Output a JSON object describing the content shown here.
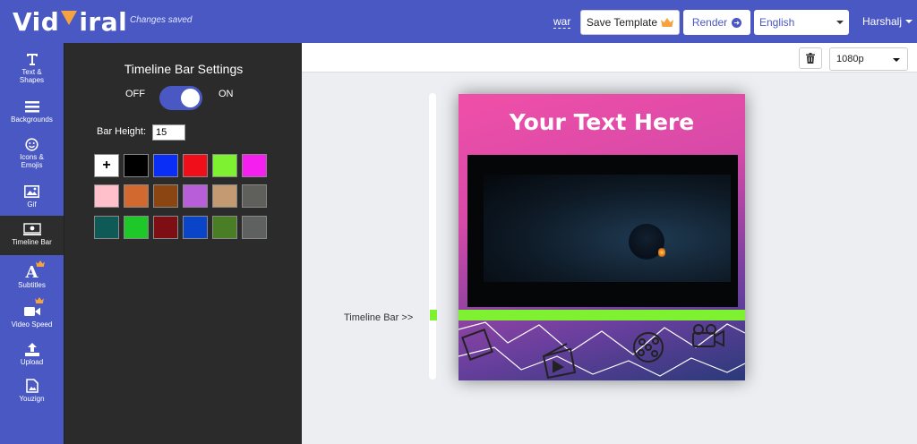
{
  "header": {
    "logo_left": "Vid",
    "logo_right": "iral",
    "status": "Changes saved",
    "war_link": "war",
    "save_template_label": "Save Template",
    "render_label": "Render",
    "language": "English",
    "user": "Harshalj"
  },
  "sidebar": {
    "items": [
      {
        "label": "Text &\nShapes",
        "icon": "text-icon"
      },
      {
        "label": "Backgrounds",
        "icon": "lines-icon"
      },
      {
        "label": "Icons &\nEmojis",
        "icon": "smiley-icon"
      },
      {
        "label": "Gif",
        "icon": "image-icon"
      },
      {
        "label": "Timeline Bar",
        "icon": "timeline-icon"
      },
      {
        "label": "Subtitles",
        "icon": "subtitle-icon"
      },
      {
        "label": "Video Speed",
        "icon": "video-camera-icon"
      },
      {
        "label": "Upload",
        "icon": "upload-icon"
      },
      {
        "label": "Youzign",
        "icon": "youzign-icon"
      }
    ]
  },
  "panel": {
    "title": "Timeline Bar Settings",
    "off_label": "OFF",
    "on_label": "ON",
    "bar_height_label": "Bar Height:",
    "bar_height_value": "15",
    "swatches": [
      "#000000",
      "#0a2ef5",
      "#f00e1a",
      "#7ef230",
      "#f51ff0",
      "#ffc0cb",
      "#d2692e",
      "#8b4513",
      "#b85ed8",
      "#c49a72",
      "#5f605c",
      "#0f5a56",
      "#1ec828",
      "#7d0e14",
      "#0a44c8",
      "#4a7e26",
      "#5f6060"
    ]
  },
  "toolbar": {
    "resolution": "1080p"
  },
  "stage": {
    "timeline_label": "Timeline Bar >>",
    "video_title": "Your Text Here"
  },
  "colors": {
    "brand": "#4a58c4",
    "panel_bg": "#2b2b2b",
    "timeline_bar": "#7ef230",
    "crown": "#f4a340"
  }
}
